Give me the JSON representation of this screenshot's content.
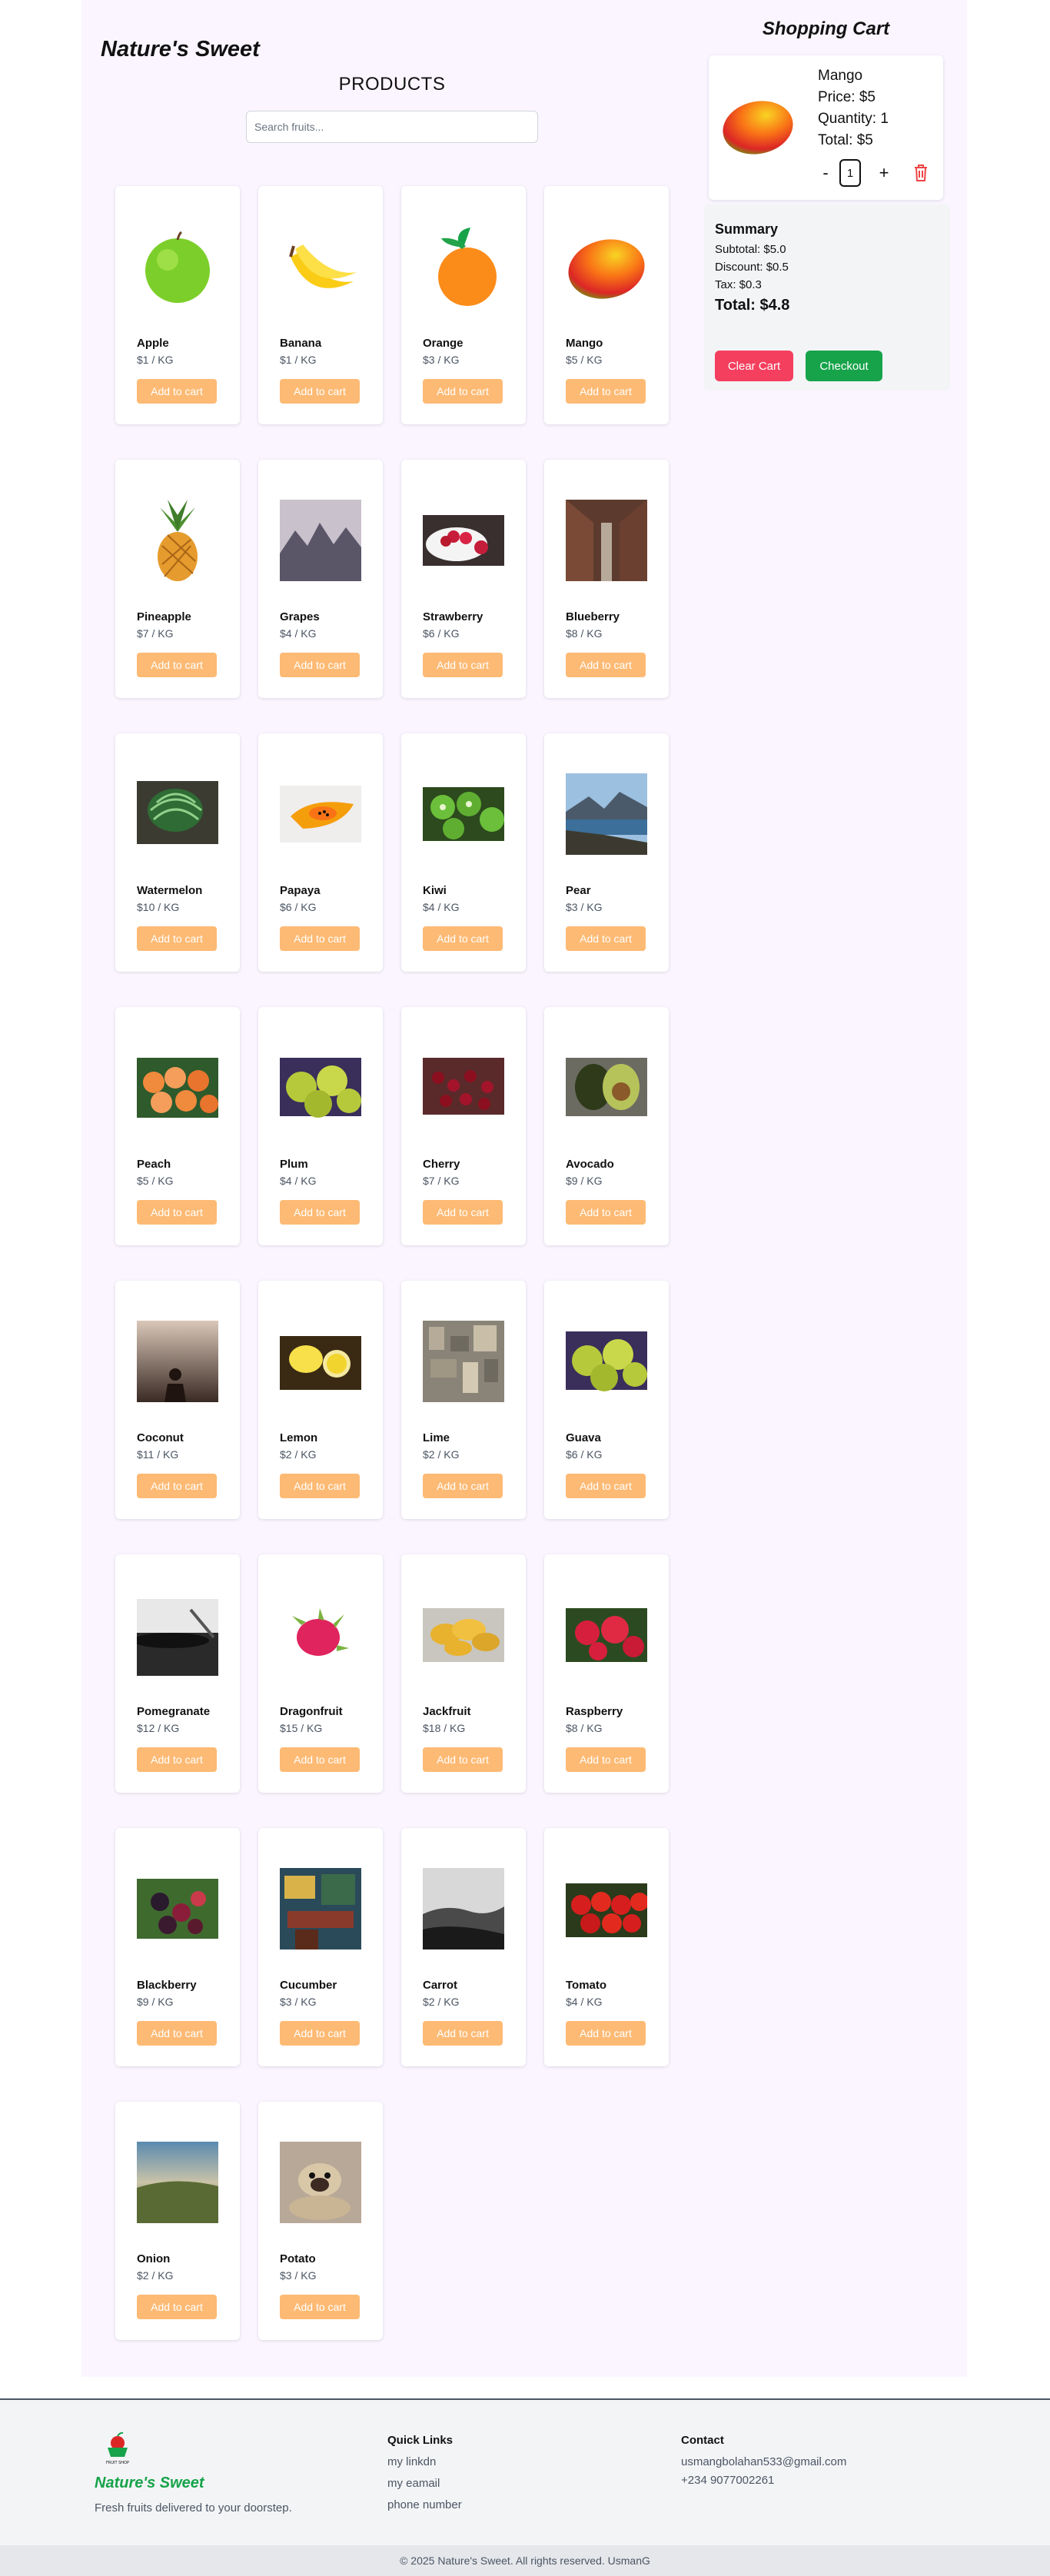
{
  "header": {
    "brand": "Nature's Sweet",
    "products_title": "PRODUCTS",
    "search_placeholder": "Search fruits..."
  },
  "products": [
    {
      "name": "Apple",
      "price": "$1 / KG",
      "image": "apple"
    },
    {
      "name": "Banana",
      "price": "$1 / KG",
      "image": "banana"
    },
    {
      "name": "Orange",
      "price": "$3 / KG",
      "image": "orange"
    },
    {
      "name": "Mango",
      "price": "$5 / KG",
      "image": "mango"
    },
    {
      "name": "Pineapple",
      "price": "$7 / KG",
      "image": "pineapple"
    },
    {
      "name": "Grapes",
      "price": "$4 / KG",
      "image": "mountain-photo"
    },
    {
      "name": "Strawberry",
      "price": "$6 / KG",
      "image": "strawberry-bowl"
    },
    {
      "name": "Blueberry",
      "price": "$8 / KG",
      "image": "alley-photo"
    },
    {
      "name": "Watermelon",
      "price": "$10 / KG",
      "image": "watermelon"
    },
    {
      "name": "Papaya",
      "price": "$6 / KG",
      "image": "papaya"
    },
    {
      "name": "Kiwi",
      "price": "$4 / KG",
      "image": "kiwi"
    },
    {
      "name": "Pear",
      "price": "$3 / KG",
      "image": "fjord-photo"
    },
    {
      "name": "Peach",
      "price": "$5 / KG",
      "image": "peaches"
    },
    {
      "name": "Plum",
      "price": "$4 / KG",
      "image": "green-fruit"
    },
    {
      "name": "Cherry",
      "price": "$7 / KG",
      "image": "cherries"
    },
    {
      "name": "Avocado",
      "price": "$9 / KG",
      "image": "avocado"
    },
    {
      "name": "Coconut",
      "price": "$11 / KG",
      "image": "sunset-person"
    },
    {
      "name": "Lemon",
      "price": "$2 / KG",
      "image": "lemons"
    },
    {
      "name": "Lime",
      "price": "$2 / KG",
      "image": "city-aerial"
    },
    {
      "name": "Guava",
      "price": "$6 / KG",
      "image": "green-fruit"
    },
    {
      "name": "Pomegranate",
      "price": "$12 / KG",
      "image": "turntable"
    },
    {
      "name": "Dragonfruit",
      "price": "$15 / KG",
      "image": "dragonfruit"
    },
    {
      "name": "Jackfruit",
      "price": "$18 / KG",
      "image": "jackfruit"
    },
    {
      "name": "Raspberry",
      "price": "$8 / KG",
      "image": "raspberries"
    },
    {
      "name": "Blackberry",
      "price": "$9 / KG",
      "image": "blackberries"
    },
    {
      "name": "Cucumber",
      "price": "$3 / KG",
      "image": "cafe-photo"
    },
    {
      "name": "Carrot",
      "price": "$2 / KG",
      "image": "bw-landscape"
    },
    {
      "name": "Tomato",
      "price": "$4 / KG",
      "image": "tomatoes"
    },
    {
      "name": "Onion",
      "price": "$2 / KG",
      "image": "valley-photo"
    },
    {
      "name": "Potato",
      "price": "$3 / KG",
      "image": "pug-photo"
    }
  ],
  "product_button_label": "Add to cart",
  "cart": {
    "title": "Shopping Cart",
    "item": {
      "name": "Mango",
      "price": "Price: $5",
      "quantity": "Quantity: 1",
      "total": "Total: $5",
      "qty_value": "1",
      "minus": "-",
      "plus": "+",
      "image": "mango"
    },
    "summary": {
      "heading": "Summary",
      "subtotal": "Subtotal: $5.0",
      "discount": "Discount: $0.5",
      "tax": "Tax: $0.3",
      "total": "Total: $4.8"
    },
    "clear_label": "Clear Cart",
    "checkout_label": "Checkout"
  },
  "footer": {
    "brand": "Nature's Sweet",
    "tagline": "Fresh fruits delivered to your doorstep.",
    "logo_text": "FRUIT SHOP",
    "quick_links_heading": "Quick Links",
    "links": [
      "my linkdn",
      "my eamail",
      "phone number"
    ],
    "contact_heading": "Contact",
    "email": "usmangbolahan533@gmail.com",
    "phone": "+234 9077002261",
    "copyright": "© 2025 Nature's Sweet. All rights reserved. UsmanG"
  },
  "colors": {
    "add_button": "#fdba74",
    "clear_button": "#f43f5e",
    "checkout_button": "#16a34a",
    "brand_green": "#16a34a",
    "page_bg": "#faf5ff"
  }
}
